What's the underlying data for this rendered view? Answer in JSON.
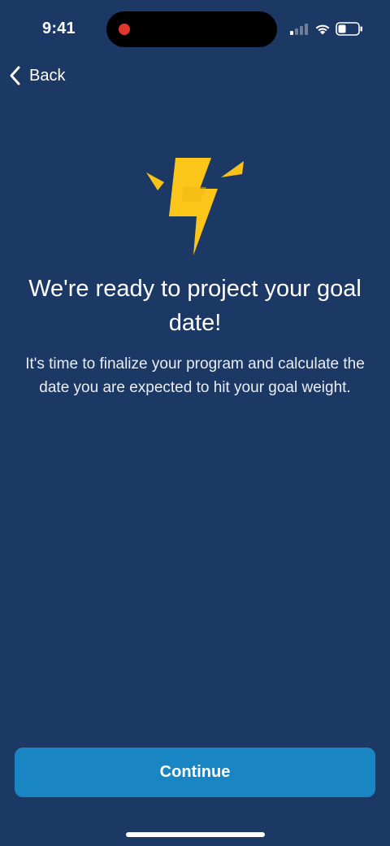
{
  "status_bar": {
    "time": "9:41",
    "recording_indicator_color": "#e0382e"
  },
  "nav": {
    "back_label": "Back",
    "back_icon": "chevron-left-icon"
  },
  "hero": {
    "icon": "lightning-bolt-icon",
    "icon_color": "#f9c315",
    "title": "We're ready to project your goal date!",
    "description": "It's time to finalize your program and calculate the date you are expected to hit your goal weight."
  },
  "actions": {
    "continue_label": "Continue"
  },
  "colors": {
    "background": "#1c3864",
    "primary_button": "#1a85c3",
    "text": "#ffffff"
  }
}
